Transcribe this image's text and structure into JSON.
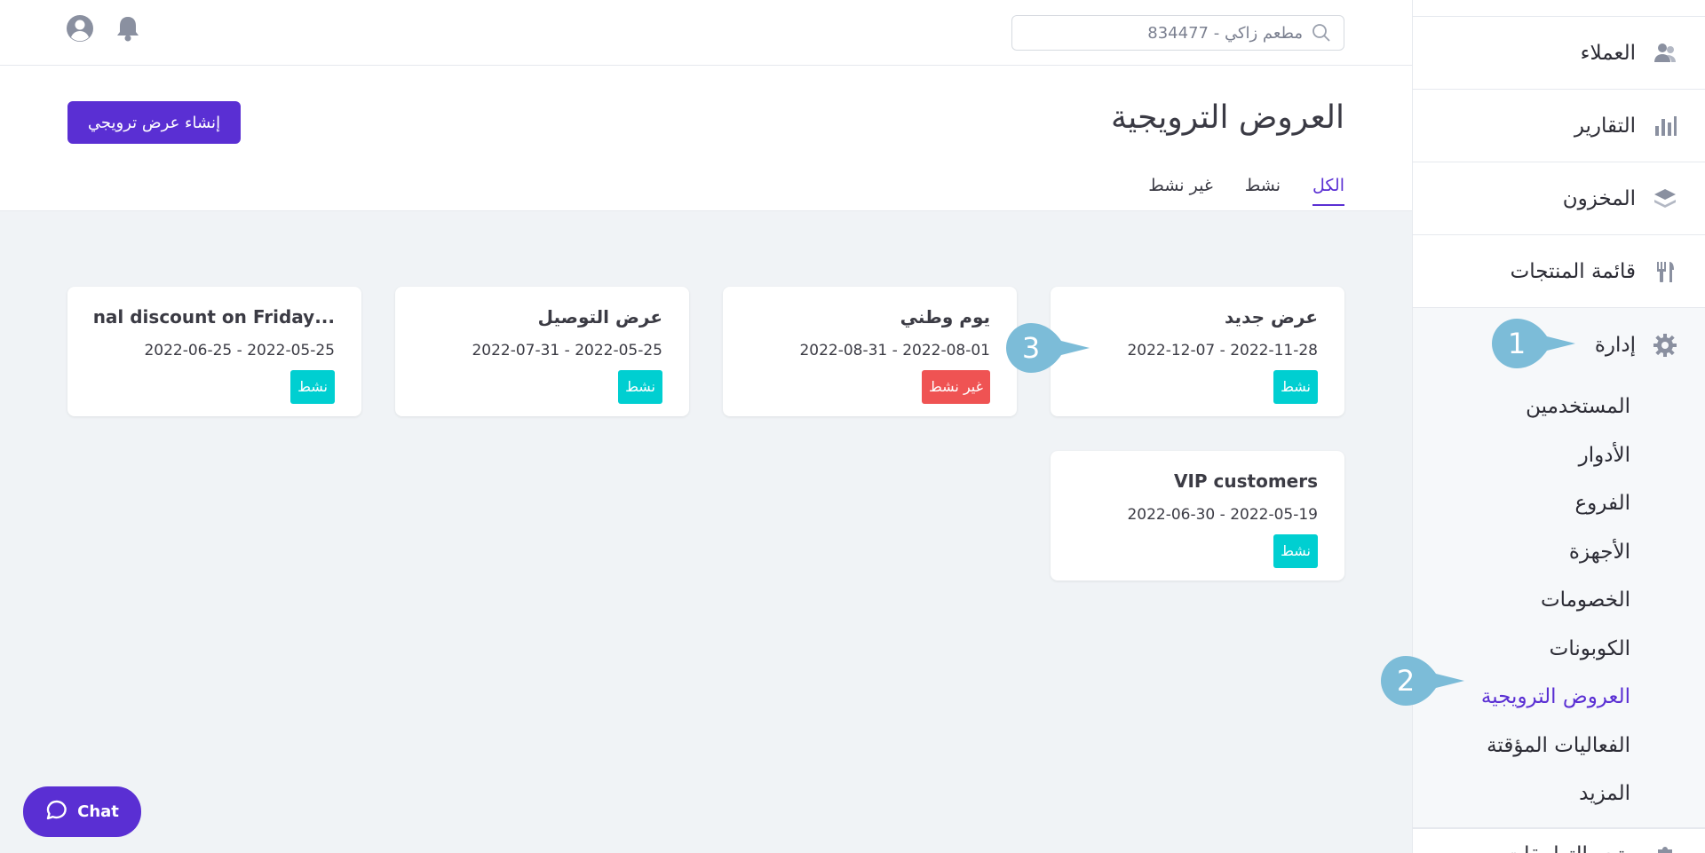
{
  "topbar": {
    "search_value": "مطعم زاكي - 834477"
  },
  "header": {
    "title": "العروض الترويجية",
    "create_button": "إنشاء عرض ترويجي",
    "tabs": [
      "الكل",
      "نشط",
      "غير نشط"
    ]
  },
  "sidebar": {
    "items": [
      "العملاء",
      "التقارير",
      "المخزون",
      "قائمة المنتجات"
    ],
    "group_title": "إدارة",
    "sub_items": [
      "المستخدمين",
      "الأدوار",
      "الفروع",
      "الأجهزة",
      "الخصومات",
      "الكوبونات",
      "العروض الترويجية",
      "الفعاليات المؤقتة",
      "المزيد"
    ],
    "bottom_item": "متجر التطبيقات"
  },
  "cards": [
    {
      "title": "عرض جديد",
      "dates": "2022-11-28 - 2022-12-07",
      "status": "نشط"
    },
    {
      "title": "يوم وطني",
      "dates": "2022-08-01 - 2022-08-31",
      "status": "غير نشط"
    },
    {
      "title": "عرض التوصيل",
      "dates": "2022-05-25 - 2022-07-31",
      "status": "نشط"
    },
    {
      "title": "...sonal discount on Friday",
      "dates": "2022-05-25 - 2022-06-25",
      "status": "نشط"
    },
    {
      "title": "VIP customers",
      "dates": "2022-05-19 - 2022-06-30",
      "status": "نشط"
    }
  ],
  "callouts": [
    "1",
    "2",
    "3"
  ],
  "chat": {
    "label": "Chat"
  },
  "colors": {
    "accent": "#5a2fd3",
    "active": "#00cfd1",
    "inactive": "#ef5353",
    "callout": "#7cbcd8"
  }
}
